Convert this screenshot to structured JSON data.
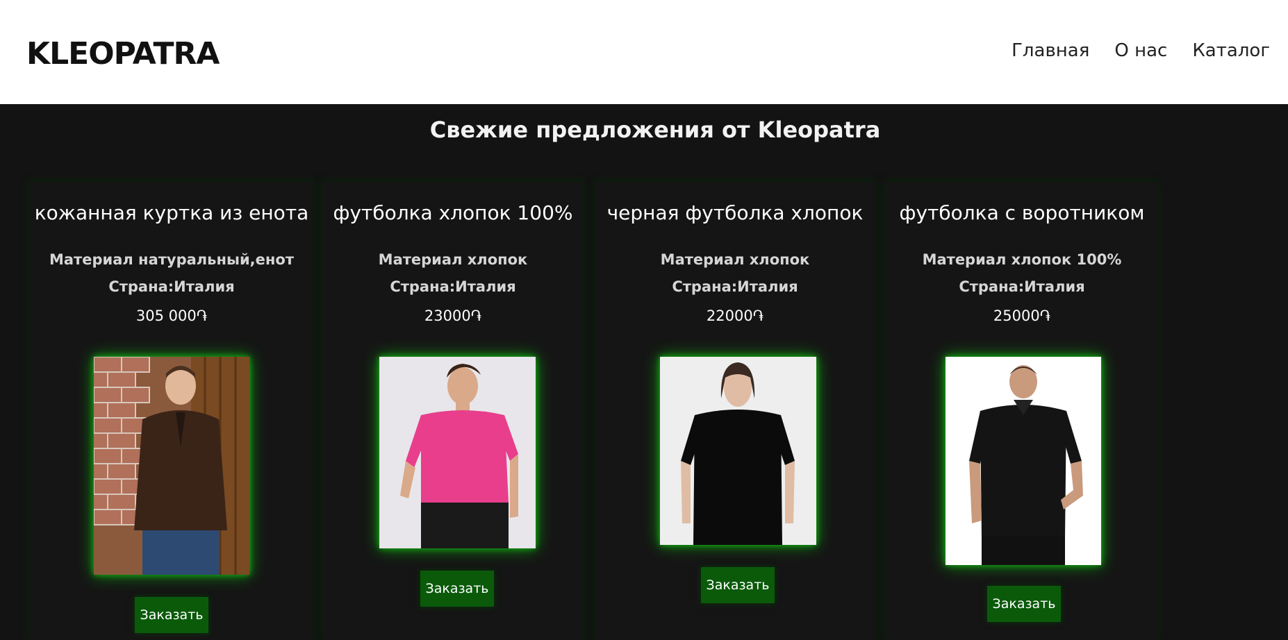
{
  "header": {
    "logo": "KLEOPATRA",
    "nav": [
      "Главная",
      "О нас",
      "Каталог"
    ]
  },
  "main": {
    "title": "Свежие предложения от Kleopatra",
    "products": [
      {
        "name": "кожанная куртка из енота",
        "material": "Материал натуральный,енот",
        "country": "Страна:Италия",
        "price": "305 000֏",
        "order_label": "Заказать",
        "image": "man-leather-jacket-photo"
      },
      {
        "name": "футболка хлопок 100%",
        "material": "Материал хлопок",
        "country": "Страна:Италия",
        "price": "23000֏",
        "order_label": "Заказать",
        "image": "man-pink-tshirt-photo"
      },
      {
        "name": "черная футболка хлопок",
        "material": "Материал хлопок",
        "country": "Страна:Италия",
        "price": "22000֏",
        "order_label": "Заказать",
        "image": "man-black-tshirt-photo"
      },
      {
        "name": "футболка с воротником",
        "material": "Материал хлопок 100%",
        "country": "Страна:Италия",
        "price": "25000֏",
        "order_label": "Заказать",
        "image": "man-black-polo-photo"
      }
    ]
  },
  "colors": {
    "background": "#131313",
    "header_bg": "#ffffff",
    "button_bg": "#0a5a0a",
    "glow": "#0f9d0f"
  }
}
